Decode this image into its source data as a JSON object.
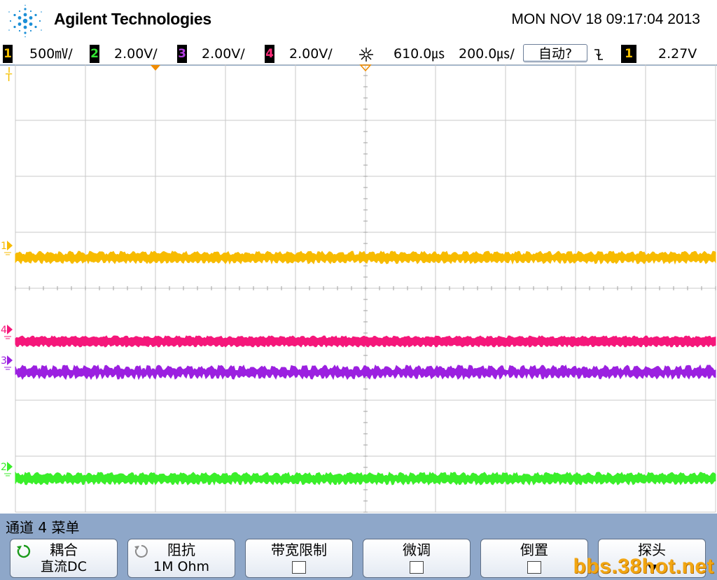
{
  "header": {
    "brand": "Agilent Technologies",
    "datetime": "MON NOV 18 09:17:04 2013"
  },
  "statusbar": {
    "channels": [
      {
        "num": "1",
        "scale": "500㎷/",
        "color": "#f5c000"
      },
      {
        "num": "2",
        "scale": "2.00V/",
        "color": "#33e633"
      },
      {
        "num": "3",
        "scale": "2.00V/",
        "color": "#b23ee0"
      },
      {
        "num": "4",
        "scale": "2.00V/",
        "color": "#ff2d7a"
      }
    ],
    "time_position": "610.0㎲",
    "time_scale": "200.0㎲/",
    "trigger_mode": "自动?",
    "trigger_slope_icon": "falling-edge-icon",
    "trigger_source": "1",
    "trigger_level": "2.27V"
  },
  "screen": {
    "grid_color": "#c8c8c8",
    "background": "#ffffff",
    "traces": [
      {
        "channel": "1",
        "marker": "1",
        "color": "#f7bb00",
        "level_divisions": 3.45,
        "noise": 3
      },
      {
        "channel": "4",
        "marker": "4",
        "color": "#f5177a",
        "level_divisions": 4.95,
        "noise": 2
      },
      {
        "channel": "3",
        "marker": "3",
        "color": "#9b20e0",
        "level_divisions": 5.5,
        "noise": 4
      },
      {
        "channel": "2",
        "marker": "2",
        "color": "#3aee2a",
        "level_divisions": 7.4,
        "noise": 3
      }
    ],
    "trigger_level_marker": "T"
  },
  "menu": {
    "title": "通道 4 菜单",
    "softkeys": [
      {
        "line1": "耦合",
        "line2": "直流DC",
        "icon": "rotate-knob-icon",
        "icon_color": "#1a9a1a"
      },
      {
        "line1": "阻抗",
        "line2": "1M Ohm",
        "icon": "rotate-knob-icon",
        "icon_color": "#8a8a8a"
      },
      {
        "line1": "带宽限制",
        "line2": "",
        "checkbox": true
      },
      {
        "line1": "微调",
        "line2": "",
        "checkbox": true
      },
      {
        "line1": "倒置",
        "line2": "",
        "checkbox": true
      },
      {
        "line1": "探头",
        "line2": "",
        "icon": "down-arrow-icon"
      }
    ],
    "watermark": "bbs.38hot.net"
  }
}
